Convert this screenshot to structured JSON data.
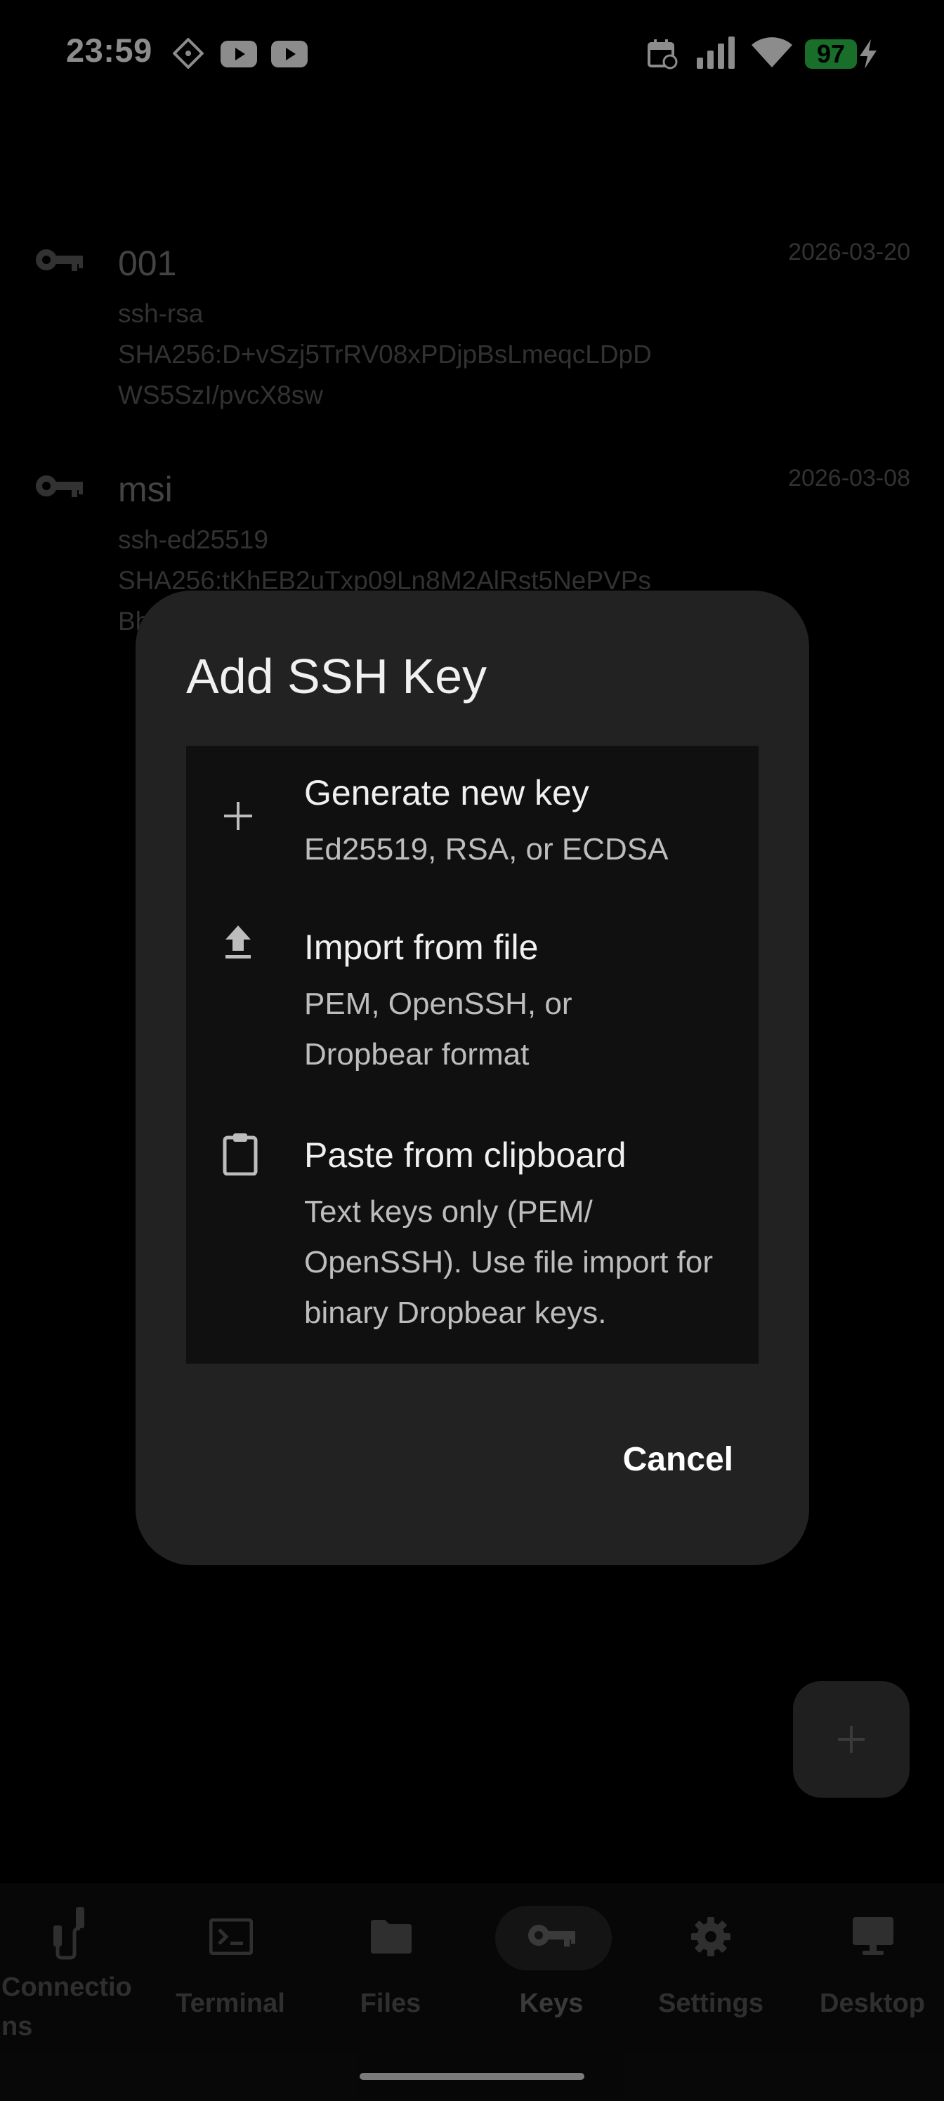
{
  "status_bar": {
    "time": "23:59",
    "battery_level": "97",
    "icons": [
      "nfc-diamond-icon",
      "youtube-icon",
      "youtube-icon",
      "calendar-icon",
      "signal-icon",
      "wifi-icon",
      "battery-icon",
      "charging-bolt-icon"
    ]
  },
  "keys": [
    {
      "name": "001",
      "type": "ssh-rsa",
      "fingerprint_line1": "SHA256:D+vSzj5TrRV08xPDjpBsLmeqcLDpD",
      "fingerprint_line2": "WS5SzI/pvcX8sw",
      "date": "2026-03-20"
    },
    {
      "name": "msi",
      "type": "ssh-ed25519",
      "fingerprint_line1": "SHA256:tKhEB2uTxp09Ln8M2AlRst5NePVPs",
      "fingerprint_line2": "Bh",
      "date": "2026-03-08"
    }
  ],
  "dialog": {
    "title": "Add SSH Key",
    "options": [
      {
        "title": "Generate new key",
        "subtitle": "Ed25519, RSA, or ECDSA",
        "icon": "plus-icon"
      },
      {
        "title": "Import from file",
        "subtitle": "PEM, OpenSSH, or Dropbear format",
        "icon": "upload-icon"
      },
      {
        "title": "Paste from clipboard",
        "subtitle": "Text keys only (PEM/ OpenSSH). Use file import for binary Dropbear keys.",
        "icon": "clipboard-icon"
      }
    ],
    "cancel_label": "Cancel"
  },
  "fab": {
    "icon": "plus-icon"
  },
  "bottom_nav": {
    "items": [
      {
        "label": "Connectio",
        "label_line2": "ns",
        "icon": "cable-icon"
      },
      {
        "label": "Terminal",
        "icon": "terminal-icon"
      },
      {
        "label": "Files",
        "icon": "folder-icon"
      },
      {
        "label": "Keys",
        "icon": "key-icon",
        "active": true
      },
      {
        "label": "Settings",
        "icon": "gear-icon"
      },
      {
        "label": "Desktop",
        "icon": "monitor-icon"
      }
    ]
  },
  "colors": {
    "background": "#000000",
    "dialog": "#222222",
    "options_panel": "#101010",
    "battery": "#2ec84e",
    "nav_active_pill": "#262626"
  }
}
